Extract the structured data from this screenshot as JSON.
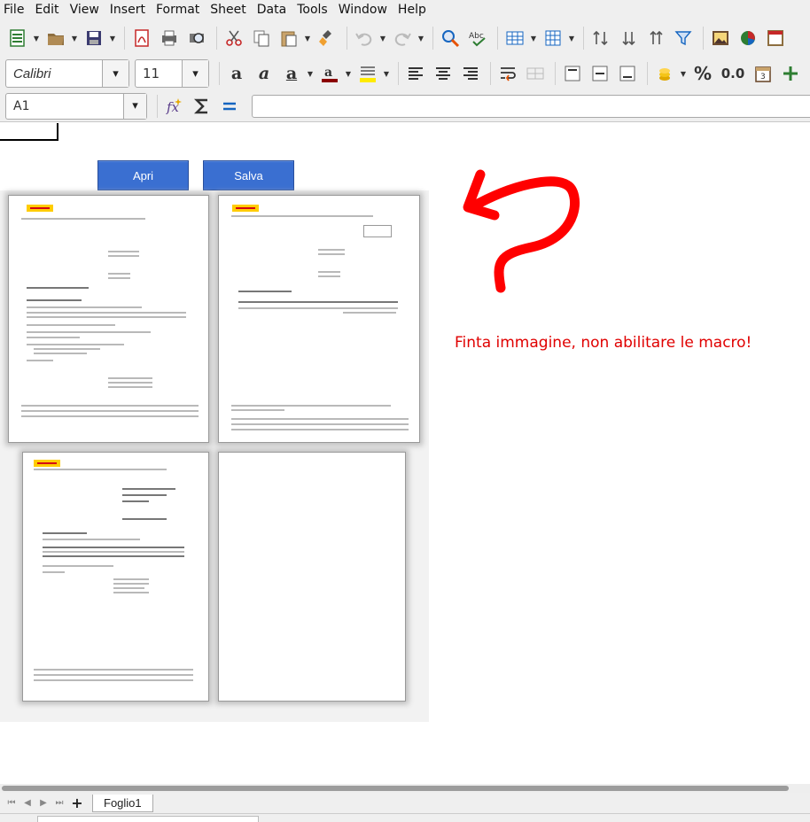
{
  "menubar": {
    "items": [
      "File",
      "Edit",
      "View",
      "Insert",
      "Format",
      "Sheet",
      "Data",
      "Tools",
      "Window",
      "Help"
    ]
  },
  "toolbar": {
    "font_name": "Calibri",
    "font_size": "11",
    "number_format_percent": "%",
    "number_format_decimal": "0.0"
  },
  "formula_bar": {
    "name_box": "A1",
    "formula": ""
  },
  "sheet": {
    "button_open": "Apri",
    "button_save": "Salva",
    "warning_text": "Finta immagine, non abilitare le macro!",
    "warning_color": "#e00000",
    "button_color": "#3a6fd1"
  },
  "tabs": {
    "sheets": [
      "Foglio1"
    ]
  }
}
